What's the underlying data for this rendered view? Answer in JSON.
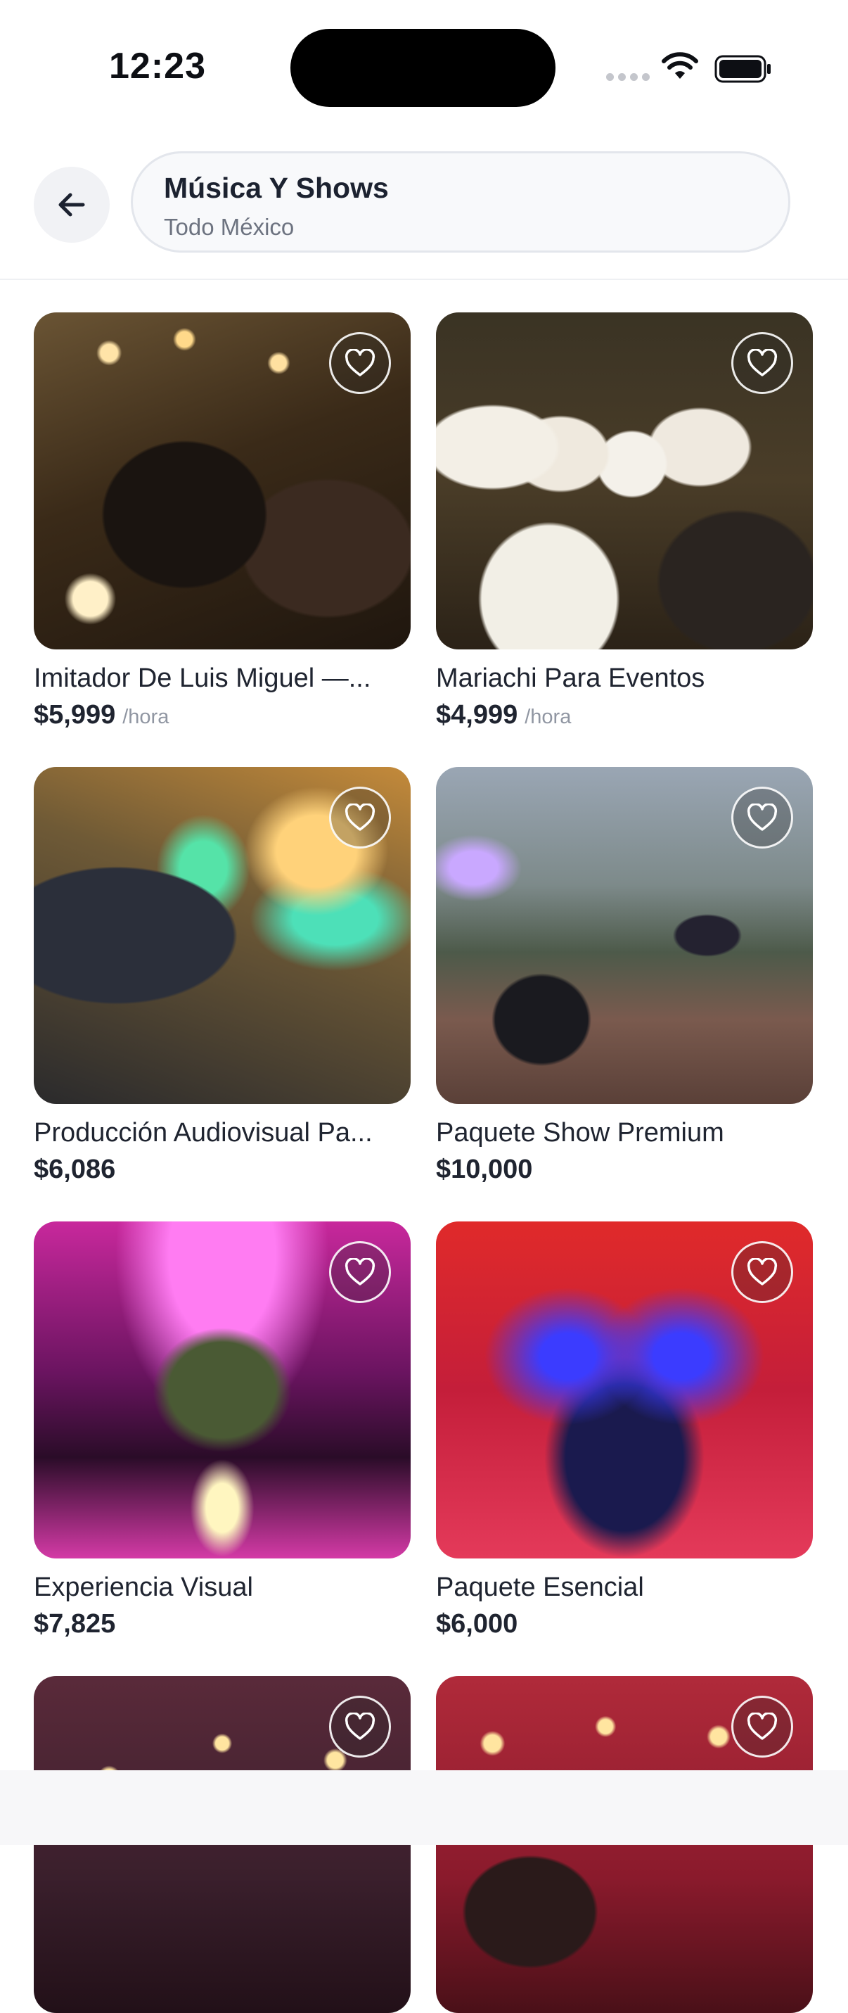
{
  "status_bar": {
    "time": "12:23"
  },
  "header": {
    "back_icon": "arrow-left-icon",
    "search": {
      "title": "Música Y Shows",
      "subtitle": "Todo México"
    }
  },
  "listings": [
    {
      "title": "Imitador De Luis Miguel —...",
      "price": "$5,999",
      "unit": "/hora",
      "favorite": false
    },
    {
      "title": "Mariachi Para Eventos",
      "price": "$4,999",
      "unit": "/hora",
      "favorite": false
    },
    {
      "title": "Producción Audiovisual Pa...",
      "price": "$6,086",
      "unit": "",
      "favorite": false
    },
    {
      "title": "Paquete Show Premium",
      "price": "$10,000",
      "unit": "",
      "favorite": false
    },
    {
      "title": "Experiencia Visual",
      "price": "$7,825",
      "unit": "",
      "favorite": false
    },
    {
      "title": "Paquete Esencial",
      "price": "$6,000",
      "unit": "",
      "favorite": false
    },
    {
      "title": "",
      "price": "",
      "unit": "",
      "favorite": false
    },
    {
      "title": "",
      "price": "",
      "unit": "",
      "favorite": false
    }
  ],
  "icons": {
    "favorite": "heart-icon",
    "wifi": "wifi-icon",
    "battery": "battery-icon",
    "signal": "signal-icon"
  }
}
